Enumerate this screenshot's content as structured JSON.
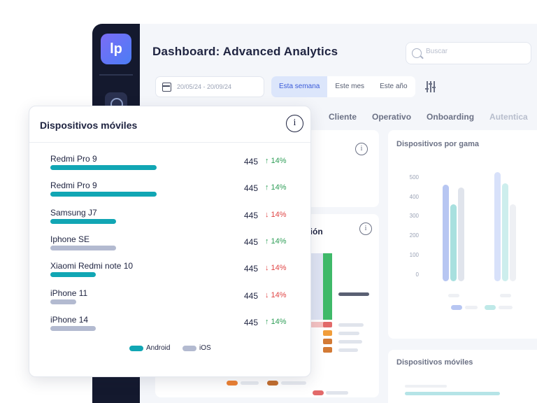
{
  "app": {
    "logo_text": "lp",
    "title": "Dashboard: Advanced Analytics",
    "search": {
      "placeholder": "Buscar"
    },
    "date_range": "20/05/24 - 20/09/24",
    "period_buttons": [
      {
        "label": "Esta semana",
        "active": true
      },
      {
        "label": "Este mes",
        "active": false
      },
      {
        "label": "Este año",
        "active": false
      }
    ],
    "tabs": [
      "Cliente",
      "Operativo",
      "Onboarding",
      "Autentica"
    ],
    "background_panels": {
      "gama_title": "Dispositivos por gama",
      "gama_axis_ticks": [
        "500",
        "400",
        "300",
        "200",
        "100",
        "0"
      ],
      "moviles_title": "Dispositivos móviles",
      "partial_title": "ción"
    }
  },
  "overlay": {
    "title": "Dispositivos móviles",
    "info_glyph": "i",
    "rows": [
      {
        "name": "Redmi Pro 9",
        "os": "Android",
        "bar": 0.82,
        "value": "445",
        "trend": "up",
        "pct": "14%"
      },
      {
        "name": "Redmi Pro 9",
        "os": "Android",
        "bar": 0.82,
        "value": "445",
        "trend": "up",
        "pct": "14%"
      },
      {
        "name": "Samsung J7",
        "os": "Android",
        "bar": 0.51,
        "value": "445",
        "trend": "down",
        "pct": "14%"
      },
      {
        "name": "Iphone SE",
        "os": "iOS",
        "bar": 0.51,
        "value": "445",
        "trend": "up",
        "pct": "14%"
      },
      {
        "name": "Xiaomi Redmi note 10",
        "os": "Android",
        "bar": 0.35,
        "value": "445",
        "trend": "down",
        "pct": "14%"
      },
      {
        "name": "iPhone 11",
        "os": "iOS",
        "bar": 0.2,
        "value": "445",
        "trend": "down",
        "pct": "14%"
      },
      {
        "name": "iPhone 14",
        "os": "iOS",
        "bar": 0.35,
        "value": "445",
        "trend": "up",
        "pct": "14%"
      }
    ],
    "legend": [
      {
        "label": "Android",
        "color": "#11a6b4"
      },
      {
        "label": "iOS",
        "color": "#b3bad0"
      }
    ],
    "colors": {
      "up": "#2e9e57",
      "down": "#e04545",
      "android": "#11a6b4",
      "ios": "#b3bad0"
    }
  }
}
